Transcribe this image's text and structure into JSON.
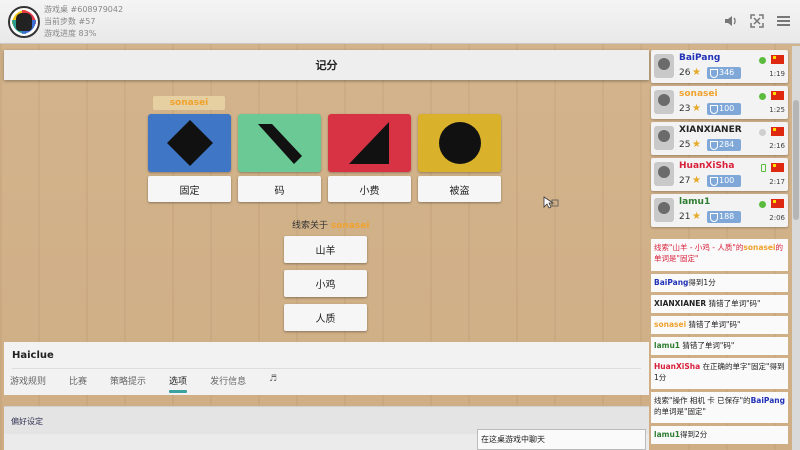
{
  "header": {
    "table_line": "游戏桌 #608979042",
    "step_line": "当前步数 #57",
    "progress_line": "游戏进度 83%"
  },
  "main": {
    "title": "记分",
    "player_tag": "sonasei",
    "cards": [
      {
        "color": "#3f76c5",
        "shape": "diamond",
        "label": "固定"
      },
      {
        "color": "#6bc995",
        "shape": "bar",
        "label": "码"
      },
      {
        "color": "#d83344",
        "shape": "triangle",
        "label": "小费"
      },
      {
        "color": "#d9b12a",
        "shape": "circle",
        "label": "被盗"
      }
    ],
    "clue_prefix": "线索关于",
    "clue_player": "sonasei",
    "clue_words": [
      "山羊",
      "小鸡",
      "人质"
    ]
  },
  "info": {
    "game_name": "Haiclue",
    "tabs": [
      "游戏规则",
      "比赛",
      "策略提示",
      "选项",
      "发行信息",
      "♬"
    ],
    "active_tab": "选项",
    "preferences": "偏好设定"
  },
  "chat": {
    "placeholder": "在这桌游戏中聊天"
  },
  "players": [
    {
      "name": "BaiPang",
      "name_color": "#2232b8",
      "score": "26",
      "rank": "346",
      "time": "1:19",
      "status": "online"
    },
    {
      "name": "sonasei",
      "name_color": "#f0a22e",
      "score": "23",
      "rank": "100",
      "time": "1:25",
      "status": "online"
    },
    {
      "name": "XIANXIANER",
      "name_color": "#222222",
      "score": "25",
      "rank": "284",
      "time": "2:16",
      "status": "offline"
    },
    {
      "name": "HuanXiSha",
      "name_color": "#d8203a",
      "score": "27",
      "rank": "100",
      "time": "2:17",
      "status": "phone"
    },
    {
      "name": "lamu1",
      "name_color": "#2e7d32",
      "score": "21",
      "rank": "188",
      "time": "2:06",
      "status": "online"
    }
  ],
  "log": {
    "e1": {
      "text1": "线索\"山羊 - 小鸡 - 人质\"的",
      "player": "sonasei",
      "text2": "的单词是\"固定\""
    },
    "e2": {
      "player": "BaiPang",
      "text": "得到1分"
    },
    "e3": {
      "player": "XIANXIANER",
      "text": " 猜错了单词\"码\""
    },
    "e4": {
      "player": "sonasei",
      "text": " 猜错了单词\"码\""
    },
    "e5": {
      "player": "lamu1",
      "text": " 猜错了单词\"码\""
    },
    "e6": {
      "player": "HuanXiSha",
      "text": " 在正确的单字\"固定\"得到1分"
    },
    "e7": {
      "text1": "线索\"操作 相机 卡 已保存\"的",
      "player": "BaiPang",
      "text2": "的单词是\"固定\""
    },
    "e8": {
      "player": "lamu1",
      "text": "得到2分"
    }
  }
}
